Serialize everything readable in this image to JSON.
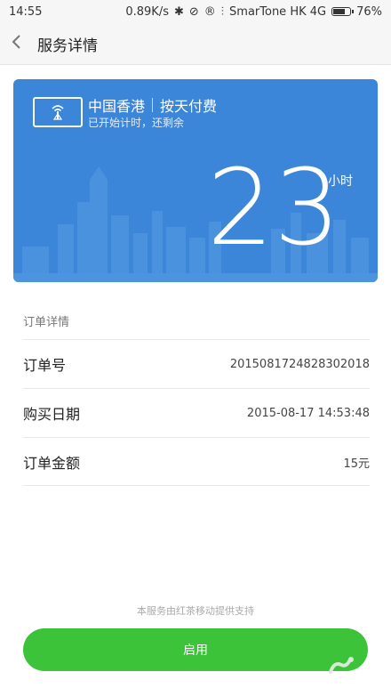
{
  "status_bar": {
    "time": "14:55",
    "net_speed": "0.89K/s",
    "carrier": "SmarTone HK 4G",
    "battery": "76%",
    "battery_level": 0.76,
    "icons": [
      "bluetooth-icon",
      "vibrate-off-icon",
      "roaming-r-icon",
      "signal-icon",
      "battery-icon"
    ]
  },
  "nav": {
    "back_icon": "chevron-left-icon",
    "title": "服务详情"
  },
  "card": {
    "icon": "wifi-hotspot-icon",
    "region": "中国香港",
    "plan": "按天付费",
    "subtitle": "已开始计时，还剩余",
    "remaining": "23",
    "unit": "小时",
    "bg_color": "#3b86d8"
  },
  "order": {
    "section_title": "订单详情",
    "rows": [
      {
        "label": "订单号",
        "value": "2015081724828302018"
      },
      {
        "label": "购买日期",
        "value": "2015-08-17 14:53:48"
      },
      {
        "label": "订单金额",
        "value": "15元"
      }
    ]
  },
  "footer": {
    "note": "本服务由红茶移动提供支持",
    "enable_button": "启用",
    "button_color": "#3cc33a"
  }
}
